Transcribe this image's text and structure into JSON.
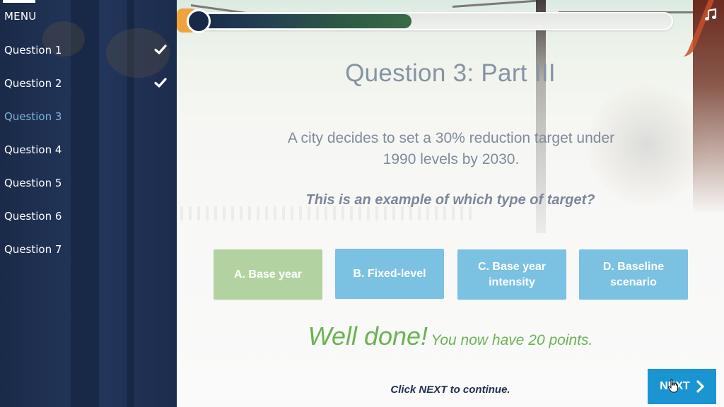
{
  "sidebar": {
    "menu_label": "MENU",
    "items": [
      {
        "label": "Question 1",
        "completed": true,
        "active": false
      },
      {
        "label": "Question 2",
        "completed": true,
        "active": false
      },
      {
        "label": "Question 3",
        "completed": false,
        "active": true
      },
      {
        "label": "Question 4",
        "completed": false,
        "active": false
      },
      {
        "label": "Question 5",
        "completed": false,
        "active": false
      },
      {
        "label": "Question 6",
        "completed": false,
        "active": false
      },
      {
        "label": "Question 7",
        "completed": false,
        "active": false
      }
    ],
    "check_icon": "checkmark-icon"
  },
  "progress": {
    "fraction": 0.46,
    "colors": {
      "start": "#172848",
      "end": "#386c45"
    }
  },
  "header": {
    "music_icon": "music-note-icon"
  },
  "question": {
    "title": "Question 3: Part III",
    "text": "A city decides to set a 30% reduction target under 1990 levels by 2030.",
    "prompt": "This is an example of which type of target?"
  },
  "answers": [
    {
      "label": "A. Base year",
      "state": "correct",
      "color": "#b2d3a1"
    },
    {
      "label": "B. Fixed-level",
      "state": "default",
      "color": "#7bc1e2"
    },
    {
      "label": "C. Base year intensity",
      "state": "default",
      "color": "#7bc1e2"
    },
    {
      "label": "D. Baseline scenario",
      "state": "default",
      "color": "#7bc1e2"
    }
  ],
  "feedback": {
    "headline": "Well done!",
    "detail": "You now have 20 points.",
    "color": "#6ab352"
  },
  "footer": {
    "hint": "Click NEXT to continue.",
    "next_label": "NEXT",
    "next_icon": "chevron-right-icon",
    "next_color": "#1a95d2"
  }
}
